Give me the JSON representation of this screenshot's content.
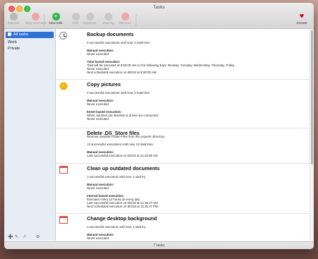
{
  "window": {
    "title": "Tasks"
  },
  "toolbar": [
    {
      "label": "Execute",
      "icon": "play-icon",
      "color": "#b8b8b8"
    },
    {
      "label": "Stop execution",
      "icon": "stop-icon",
      "color": "#f0a6a6"
    },
    {
      "label": "New task",
      "icon": "plus-icon",
      "color": "#2fb44a"
    },
    {
      "label": "Edit",
      "icon": "gear-icon",
      "color": "#c8c8c8"
    },
    {
      "label": "Duplicate",
      "icon": "duplicate-icon",
      "color": "#c8c8c8"
    },
    {
      "label": "View log",
      "icon": "document-icon",
      "color": "#c8c8c8"
    },
    {
      "label": "Remove",
      "icon": "remove-icon",
      "color": "#f0a6a6"
    },
    {
      "label": "Donate",
      "icon": "heart-icon",
      "color": "#d0021b"
    }
  ],
  "sidebar": {
    "items": [
      {
        "label": "All tasks",
        "selected": true
      },
      {
        "label": "Work",
        "selected": false
      },
      {
        "label": "Private",
        "selected": false
      }
    ],
    "footer_icons": [
      "add-icon",
      "edit-icon",
      "share-icon",
      "settings-icon"
    ]
  },
  "tasks": [
    {
      "icon": "clock-icon",
      "name": "Backup documents",
      "lines": [
        {
          "text": "0 successful executions until now, 0 total tries",
          "bold": false
        },
        {
          "text": "Manual execution:",
          "bold": true
        },
        {
          "text": "Never executed",
          "bold": false
        },
        {
          "text": "Time based execution:",
          "bold": true
        },
        {
          "text": "Task will be executed at 8:00:00 AM on the following days: Monday, Tuesday, Wednesday, Thursday, Friday",
          "bold": false
        },
        {
          "text": "Never executed",
          "bold": false
        },
        {
          "text": "Next scheduled execution on 8/6/18 at 8:00:00 AM",
          "bold": false
        }
      ]
    },
    {
      "icon": "hexagon-bolt-icon",
      "name": "Copy pictures",
      "lines": [
        {
          "text": "0 successful executions until now, 0 total tries",
          "bold": false
        },
        {
          "text": "Manual execution:",
          "bold": true
        },
        {
          "text": "Never executed",
          "bold": false
        },
        {
          "text": "Event based execution:",
          "bold": true
        },
        {
          "text": "When volumes are inserted or drives are connected",
          "bold": false
        },
        {
          "text": "Never executed",
          "bold": false
        }
      ]
    },
    {
      "icon": "",
      "name": "Delete .DS_Store files",
      "lines": [
        {
          "text": "Remove invisible Finder-Files from the projects directory.",
          "bold": false
        },
        {
          "text": "13 successful executions until now, 13 total tries",
          "bold": false
        },
        {
          "text": "Manual execution:",
          "bold": true
        },
        {
          "text": "Last successful execution on 8/4/18 at 11:42:58 AM",
          "bold": false
        }
      ]
    },
    {
      "icon": "calendar-icon",
      "name": "Clean up outdated documents",
      "lines": [
        {
          "text": "1 successful execution until now, 1 total try",
          "bold": false
        },
        {
          "text": "Manual execution:",
          "bold": true
        },
        {
          "text": "Never executed",
          "bold": false
        },
        {
          "text": "Interval based execution:",
          "bold": true
        },
        {
          "text": "Executes every 12 hours on every day",
          "bold": false
        },
        {
          "text": "Last successful execution on 8/4/18 at 11:45:47 AM",
          "bold": false
        },
        {
          "text": "Next scheduled execution on 8/4/18 at 11:45:47 PM",
          "bold": false
        }
      ]
    },
    {
      "icon": "calendar-icon",
      "name": "Change desktop background",
      "lines": [
        {
          "text": "1 successful execution until now, 1 total try",
          "bold": false
        },
        {
          "text": "Manual execution:",
          "bold": true
        },
        {
          "text": "Never executed",
          "bold": false
        }
      ]
    }
  ],
  "status": {
    "count": "7 tasks"
  }
}
